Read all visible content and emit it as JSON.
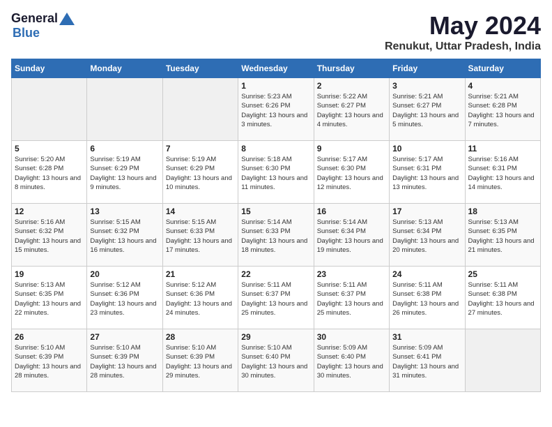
{
  "logo": {
    "general": "General",
    "blue": "Blue"
  },
  "title": {
    "month_year": "May 2024",
    "location": "Renukut, Uttar Pradesh, India"
  },
  "weekdays": [
    "Sunday",
    "Monday",
    "Tuesday",
    "Wednesday",
    "Thursday",
    "Friday",
    "Saturday"
  ],
  "weeks": [
    [
      {
        "day": "",
        "info": ""
      },
      {
        "day": "",
        "info": ""
      },
      {
        "day": "",
        "info": ""
      },
      {
        "day": "1",
        "info": "Sunrise: 5:23 AM\nSunset: 6:26 PM\nDaylight: 13 hours and 3 minutes."
      },
      {
        "day": "2",
        "info": "Sunrise: 5:22 AM\nSunset: 6:27 PM\nDaylight: 13 hours and 4 minutes."
      },
      {
        "day": "3",
        "info": "Sunrise: 5:21 AM\nSunset: 6:27 PM\nDaylight: 13 hours and 5 minutes."
      },
      {
        "day": "4",
        "info": "Sunrise: 5:21 AM\nSunset: 6:28 PM\nDaylight: 13 hours and 7 minutes."
      }
    ],
    [
      {
        "day": "5",
        "info": "Sunrise: 5:20 AM\nSunset: 6:28 PM\nDaylight: 13 hours and 8 minutes."
      },
      {
        "day": "6",
        "info": "Sunrise: 5:19 AM\nSunset: 6:29 PM\nDaylight: 13 hours and 9 minutes."
      },
      {
        "day": "7",
        "info": "Sunrise: 5:19 AM\nSunset: 6:29 PM\nDaylight: 13 hours and 10 minutes."
      },
      {
        "day": "8",
        "info": "Sunrise: 5:18 AM\nSunset: 6:30 PM\nDaylight: 13 hours and 11 minutes."
      },
      {
        "day": "9",
        "info": "Sunrise: 5:17 AM\nSunset: 6:30 PM\nDaylight: 13 hours and 12 minutes."
      },
      {
        "day": "10",
        "info": "Sunrise: 5:17 AM\nSunset: 6:31 PM\nDaylight: 13 hours and 13 minutes."
      },
      {
        "day": "11",
        "info": "Sunrise: 5:16 AM\nSunset: 6:31 PM\nDaylight: 13 hours and 14 minutes."
      }
    ],
    [
      {
        "day": "12",
        "info": "Sunrise: 5:16 AM\nSunset: 6:32 PM\nDaylight: 13 hours and 15 minutes."
      },
      {
        "day": "13",
        "info": "Sunrise: 5:15 AM\nSunset: 6:32 PM\nDaylight: 13 hours and 16 minutes."
      },
      {
        "day": "14",
        "info": "Sunrise: 5:15 AM\nSunset: 6:33 PM\nDaylight: 13 hours and 17 minutes."
      },
      {
        "day": "15",
        "info": "Sunrise: 5:14 AM\nSunset: 6:33 PM\nDaylight: 13 hours and 18 minutes."
      },
      {
        "day": "16",
        "info": "Sunrise: 5:14 AM\nSunset: 6:34 PM\nDaylight: 13 hours and 19 minutes."
      },
      {
        "day": "17",
        "info": "Sunrise: 5:13 AM\nSunset: 6:34 PM\nDaylight: 13 hours and 20 minutes."
      },
      {
        "day": "18",
        "info": "Sunrise: 5:13 AM\nSunset: 6:35 PM\nDaylight: 13 hours and 21 minutes."
      }
    ],
    [
      {
        "day": "19",
        "info": "Sunrise: 5:13 AM\nSunset: 6:35 PM\nDaylight: 13 hours and 22 minutes."
      },
      {
        "day": "20",
        "info": "Sunrise: 5:12 AM\nSunset: 6:36 PM\nDaylight: 13 hours and 23 minutes."
      },
      {
        "day": "21",
        "info": "Sunrise: 5:12 AM\nSunset: 6:36 PM\nDaylight: 13 hours and 24 minutes."
      },
      {
        "day": "22",
        "info": "Sunrise: 5:11 AM\nSunset: 6:37 PM\nDaylight: 13 hours and 25 minutes."
      },
      {
        "day": "23",
        "info": "Sunrise: 5:11 AM\nSunset: 6:37 PM\nDaylight: 13 hours and 25 minutes."
      },
      {
        "day": "24",
        "info": "Sunrise: 5:11 AM\nSunset: 6:38 PM\nDaylight: 13 hours and 26 minutes."
      },
      {
        "day": "25",
        "info": "Sunrise: 5:11 AM\nSunset: 6:38 PM\nDaylight: 13 hours and 27 minutes."
      }
    ],
    [
      {
        "day": "26",
        "info": "Sunrise: 5:10 AM\nSunset: 6:39 PM\nDaylight: 13 hours and 28 minutes."
      },
      {
        "day": "27",
        "info": "Sunrise: 5:10 AM\nSunset: 6:39 PM\nDaylight: 13 hours and 28 minutes."
      },
      {
        "day": "28",
        "info": "Sunrise: 5:10 AM\nSunset: 6:39 PM\nDaylight: 13 hours and 29 minutes."
      },
      {
        "day": "29",
        "info": "Sunrise: 5:10 AM\nSunset: 6:40 PM\nDaylight: 13 hours and 30 minutes."
      },
      {
        "day": "30",
        "info": "Sunrise: 5:09 AM\nSunset: 6:40 PM\nDaylight: 13 hours and 30 minutes."
      },
      {
        "day": "31",
        "info": "Sunrise: 5:09 AM\nSunset: 6:41 PM\nDaylight: 13 hours and 31 minutes."
      },
      {
        "day": "",
        "info": ""
      }
    ]
  ]
}
